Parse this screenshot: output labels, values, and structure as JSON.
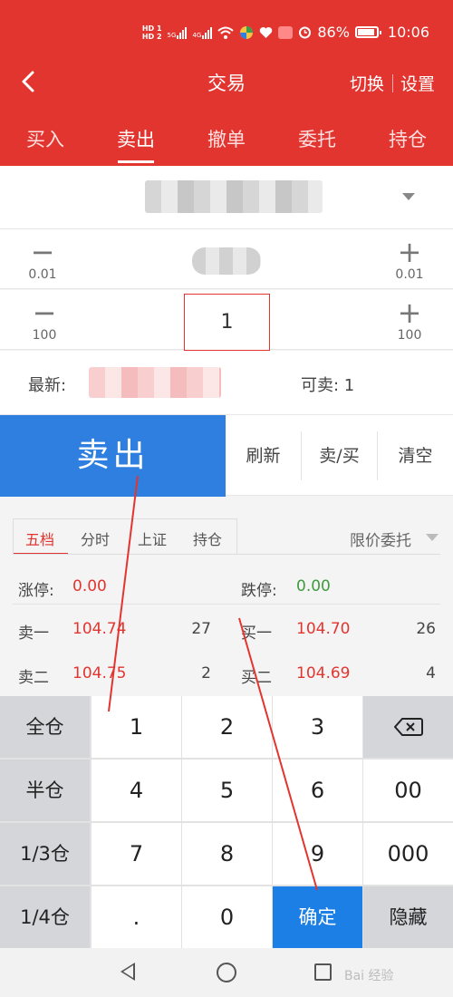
{
  "status_bar": {
    "hd1": "HD 1",
    "hd2": "HD 2",
    "net1": "5G",
    "net2": "4G",
    "battery": "86%",
    "time": "10:06"
  },
  "header": {
    "title": "交易",
    "switch_label": "切换",
    "settings_label": "设置"
  },
  "tabs": [
    {
      "label": "买入"
    },
    {
      "label": "卖出"
    },
    {
      "label": "撤单"
    },
    {
      "label": "委托"
    },
    {
      "label": "持仓"
    }
  ],
  "price_stepper": {
    "minus_step": "0.01",
    "plus_step": "0.01"
  },
  "qty_stepper": {
    "minus_step": "100",
    "plus_step": "100",
    "value": "1"
  },
  "info": {
    "latest_label": "最新:",
    "sellable_label": "可卖: 1"
  },
  "actions": {
    "sell_label": "卖出",
    "refresh_label": "刷新",
    "sell_buy_label": "卖/买",
    "clear_label": "清空"
  },
  "panel": {
    "tabs": [
      "五档",
      "分时",
      "上证",
      "持仓"
    ],
    "order_type": "限价委托",
    "limit_up_label": "涨停:",
    "limit_up_value": "0.00",
    "limit_down_label": "跌停:",
    "limit_down_value": "0.00",
    "rows": [
      {
        "sell_label": "卖一",
        "sell_price": "104.74",
        "sell_qty": "27",
        "buy_label": "买一",
        "buy_price": "104.70",
        "buy_qty": "26"
      },
      {
        "sell_label": "卖二",
        "sell_price": "104.75",
        "sell_qty": "2",
        "buy_label": "买二",
        "buy_price": "104.69",
        "buy_qty": "4"
      }
    ]
  },
  "keypad": {
    "side": [
      "全仓",
      "半仓",
      "1/3仓",
      "1/4仓"
    ],
    "digits": [
      "1",
      "2",
      "3",
      "4",
      "5",
      "6",
      "7",
      "8",
      "9",
      ".",
      "0"
    ],
    "right": [
      "00",
      "000"
    ],
    "confirm_label": "确定",
    "hide_label": "隐藏"
  },
  "watermark": "Bai 经验"
}
